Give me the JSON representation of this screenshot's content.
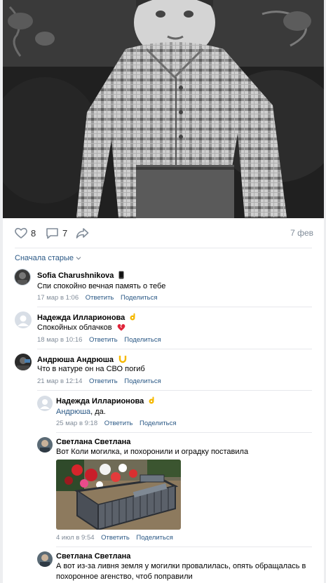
{
  "post": {
    "likes": "8",
    "comments": "7",
    "date": "7 фев"
  },
  "sort_label": "Сначала старые",
  "comments": [
    {
      "name": "Sofia Charushnikova",
      "text": "Спи спокойно вечная память о тебе",
      "time": "17 мар в 1:06",
      "reply": "Ответить",
      "share": "Поделиться"
    },
    {
      "name": "Надежда Илларионова",
      "text": "Спокойных облачков",
      "time": "18 мар в 10:16",
      "reply": "Ответить",
      "share": "Поделиться"
    },
    {
      "name": "Андрюша Андрюша",
      "text": "Что в натуре он на СВО погиб",
      "time": "21 мар в 12:14",
      "reply": "Ответить",
      "share": "Поделиться"
    },
    {
      "name": "Надежда Илларионова",
      "mention": "Андрюша",
      "text": ", да.",
      "time": "25 мар в 9:18",
      "reply": "Ответить",
      "share": "Поделиться"
    },
    {
      "name": "Светлана Светлана",
      "text": "Вот Коли могилка, и похоронили и оградку поставила",
      "time": "4 июл в 9:54",
      "reply": "Ответить",
      "share": "Поделиться"
    },
    {
      "name": "Светлана Светлана",
      "text_line1": "А вот из-за ливня земля у могилки провалилась, опять обращалась в",
      "text_line2": "похоронное агенство, чтоб поправили"
    }
  ],
  "colors": {
    "link": "#2a5885",
    "meta": "#818c99",
    "divider": "#e7e8ec"
  }
}
